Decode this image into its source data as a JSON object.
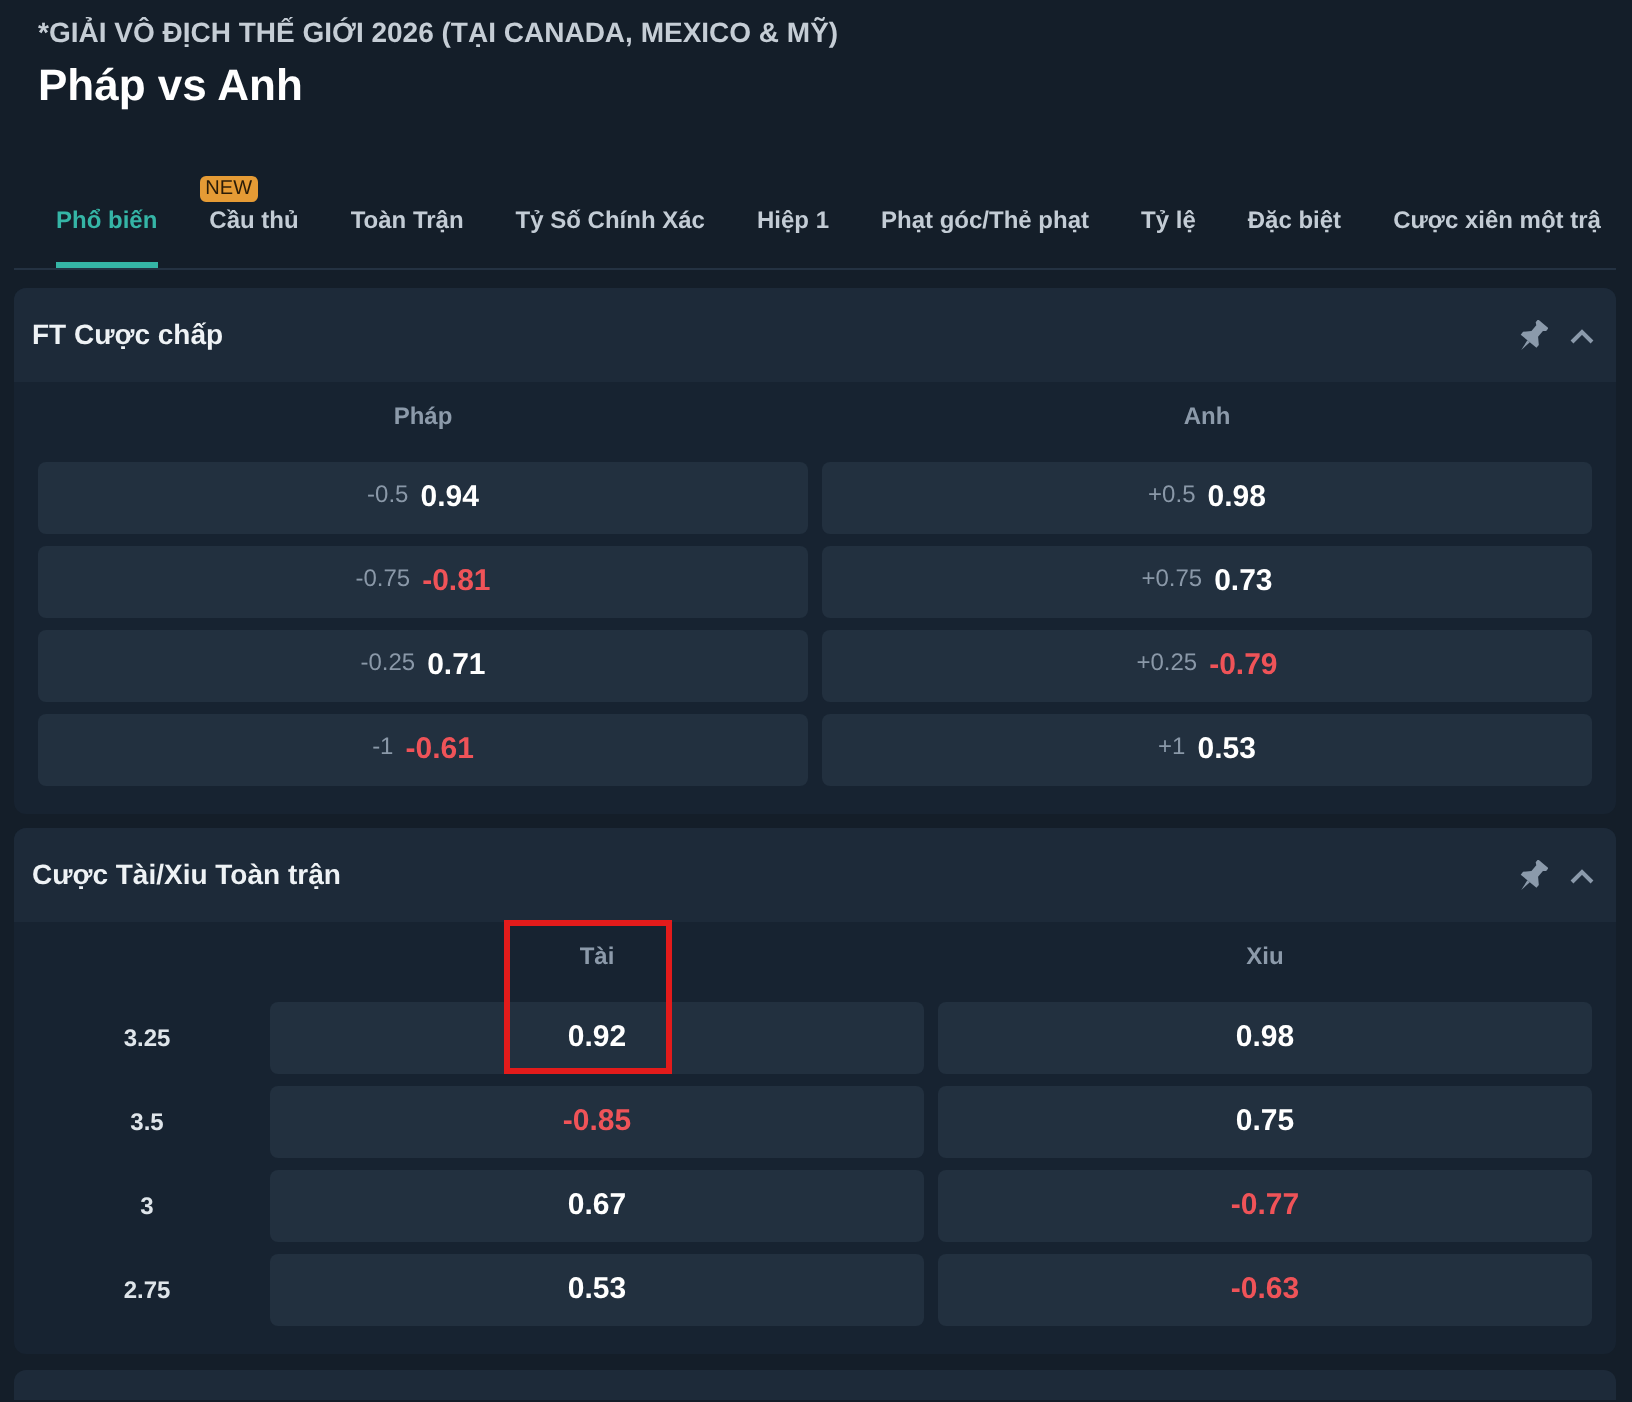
{
  "competition": "*GIẢI VÔ ĐỊCH THẾ GIỚI 2026 (TẠI CANADA, MEXICO & MỸ)",
  "match_title": "Pháp vs Anh",
  "tabs": [
    {
      "label": "Phổ biến",
      "selected": true
    },
    {
      "label": "Cầu thủ",
      "selected": false,
      "badge": "NEW"
    },
    {
      "label": "Toàn Trận",
      "selected": false
    },
    {
      "label": "Tỷ Số Chính Xác",
      "selected": false
    },
    {
      "label": "Hiệp 1",
      "selected": false
    },
    {
      "label": "Phạt góc/Thẻ phạt",
      "selected": false
    },
    {
      "label": "Tỷ lệ",
      "selected": false
    },
    {
      "label": "Đặc biệt",
      "selected": false
    },
    {
      "label": "Cược xiên một trậ",
      "selected": false
    }
  ],
  "sections": [
    {
      "kind": "handicap",
      "title": "FT Cược chấp",
      "expanded": true,
      "columns": [
        "Pháp",
        "Anh"
      ],
      "rows": [
        {
          "home": {
            "line": "-0.5",
            "odds": "0.94",
            "negative": false
          },
          "away": {
            "line": "+0.5",
            "odds": "0.98",
            "negative": false
          }
        },
        {
          "home": {
            "line": "-0.75",
            "odds": "-0.81",
            "negative": true
          },
          "away": {
            "line": "+0.75",
            "odds": "0.73",
            "negative": false
          }
        },
        {
          "home": {
            "line": "-0.25",
            "odds": "0.71",
            "negative": false
          },
          "away": {
            "line": "+0.25",
            "odds": "-0.79",
            "negative": true
          }
        },
        {
          "home": {
            "line": "-1",
            "odds": "-0.61",
            "negative": true
          },
          "away": {
            "line": "+1",
            "odds": "0.53",
            "negative": false
          }
        }
      ]
    },
    {
      "kind": "over_under",
      "title": "Cược Tài/Xiu Toàn trận",
      "expanded": true,
      "columns": [
        "Tài",
        "Xiu"
      ],
      "rows": [
        {
          "line": "3.25",
          "over": {
            "odds": "0.92",
            "negative": false,
            "highlighted": true
          },
          "under": {
            "odds": "0.98",
            "negative": false,
            "highlighted": false
          }
        },
        {
          "line": "3.5",
          "over": {
            "odds": "-0.85",
            "negative": true,
            "highlighted": false
          },
          "under": {
            "odds": "0.75",
            "negative": false,
            "highlighted": false
          }
        },
        {
          "line": "3",
          "over": {
            "odds": "0.67",
            "negative": false,
            "highlighted": false
          },
          "under": {
            "odds": "-0.77",
            "negative": true,
            "highlighted": false
          }
        },
        {
          "line": "2.75",
          "over": {
            "odds": "0.53",
            "negative": false,
            "highlighted": false
          },
          "under": {
            "odds": "-0.63",
            "negative": true,
            "highlighted": false
          }
        }
      ]
    },
    {
      "kind": "cut_off"
    }
  ]
}
